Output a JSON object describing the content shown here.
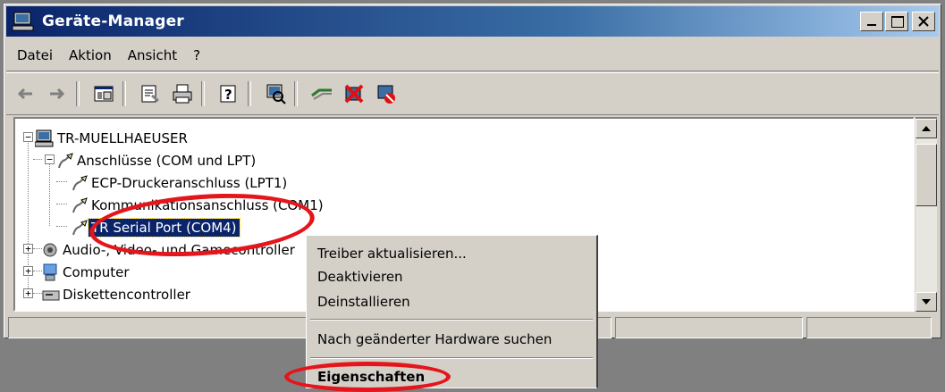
{
  "window": {
    "title": "Geräte-Manager"
  },
  "menu": [
    "Datei",
    "Aktion",
    "Ansicht",
    "?"
  ],
  "toolbar": {
    "icons": [
      "back-icon",
      "forward-icon",
      "console-tree-icon",
      "properties-icon",
      "print-icon",
      "help-icon",
      "scan-hardware-icon",
      "update-driver-icon",
      "uninstall-icon",
      "disable-icon"
    ]
  },
  "tree": {
    "root": "TR-MUELLHAEUSER",
    "ports": "Anschlüsse (COM und LPT)",
    "lpt": "ECP-Druckeranschluss (LPT1)",
    "com1": "Kommunikationsanschluss (COM1)",
    "com4": "TR Serial Port (COM4)",
    "audio": "Audio-, Video- und Gamecontroller",
    "computer": "Computer",
    "floppy": "Diskettencontroller"
  },
  "context_menu": {
    "update": "Treiber aktualisieren...",
    "disable": "Deaktivieren",
    "uninstall": "Deinstallieren",
    "scan": "Nach geänderter Hardware suchen",
    "properties": "Eigenschaften"
  },
  "colors": {
    "selection": "#0a246a",
    "highlight_ellipse": "#e4151b",
    "titlebar": "#0a246a"
  }
}
